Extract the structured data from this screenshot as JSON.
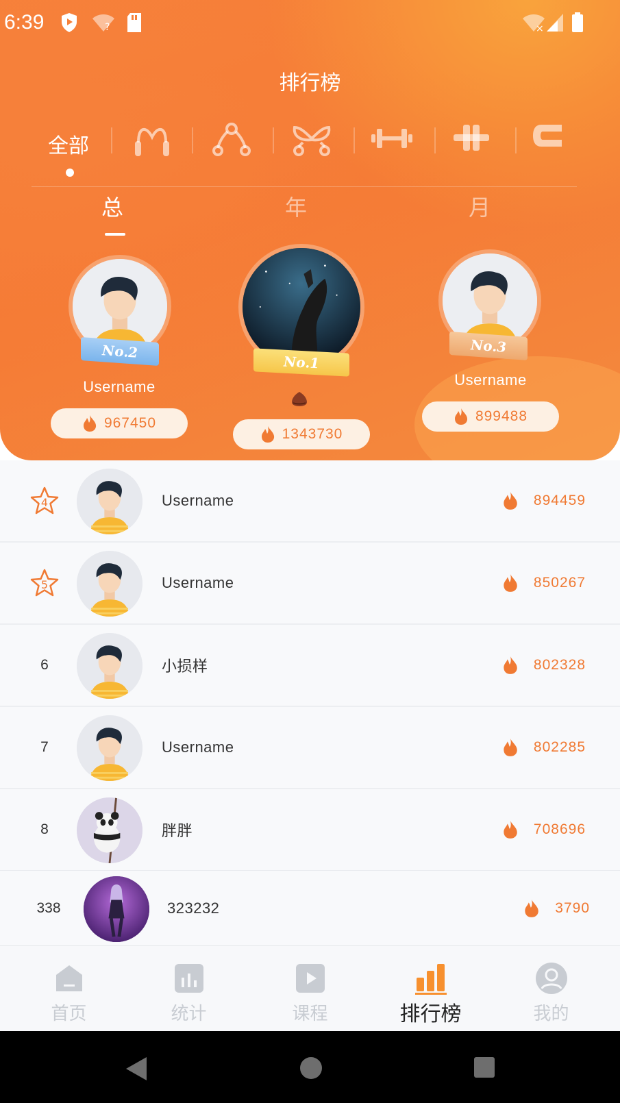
{
  "status_bar": {
    "time": "6:39"
  },
  "header": {
    "title": "排行榜"
  },
  "categories": {
    "active_label": "全部",
    "icons": [
      "jump-rope-icon",
      "resistance-band-icon",
      "ab-roller-icon",
      "dumbbell-icon",
      "barbell-icon",
      "grip-icon"
    ]
  },
  "periods": {
    "items": [
      "总",
      "年",
      "月"
    ],
    "active_index": 0
  },
  "podium": {
    "first": {
      "badge": "No.1",
      "score": "1343730"
    },
    "second": {
      "badge": "No.2",
      "name": "Username",
      "score": "967450"
    },
    "third": {
      "badge": "No.3",
      "name": "Username",
      "score": "899488"
    }
  },
  "ranking": [
    {
      "rank": "4",
      "name": "Username",
      "score": "894459"
    },
    {
      "rank": "5",
      "name": "Username",
      "score": "850267"
    },
    {
      "rank": "6",
      "name": "小损样",
      "score": "802328"
    },
    {
      "rank": "7",
      "name": "Username",
      "score": "802285"
    },
    {
      "rank": "8",
      "name": "胖胖",
      "score": "708696"
    }
  ],
  "my_rank": {
    "rank": "338",
    "name": "323232",
    "score": "3790"
  },
  "tabbar": {
    "items": [
      {
        "label": "首页",
        "icon": "home-icon"
      },
      {
        "label": "统计",
        "icon": "stats-icon"
      },
      {
        "label": "课程",
        "icon": "course-play-icon"
      },
      {
        "label": "排行榜",
        "icon": "ranking-bars-icon"
      },
      {
        "label": "我的",
        "icon": "profile-icon"
      }
    ],
    "active_index": 3
  },
  "colors": {
    "accent": "#f57a35",
    "score": "#f07a33",
    "inactive": "#c8ccd2"
  }
}
